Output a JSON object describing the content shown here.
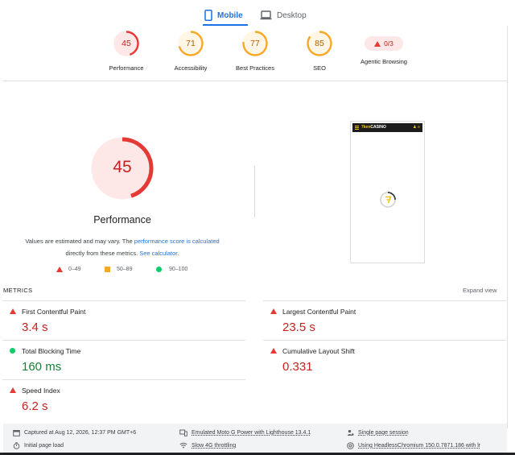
{
  "device_tabs": [
    {
      "label": "Mobile",
      "active": true
    },
    {
      "label": "Desktop",
      "active": false
    }
  ],
  "summary": [
    {
      "score": "45",
      "label": "Performance",
      "value": 0.45,
      "color": "#e53935",
      "text_color": "#c5221f",
      "bg": "#fde7e7"
    },
    {
      "score": "71",
      "label": "Accessibility",
      "value": 0.71,
      "color": "#f8a726",
      "text_color": "#b45f06",
      "bg": "#fff6e6"
    },
    {
      "score": "77",
      "label": "Best Practices",
      "value": 0.77,
      "color": "#f8a726",
      "text_color": "#b45f06",
      "bg": "#fff6e6"
    },
    {
      "score": "85",
      "label": "SEO",
      "value": 0.85,
      "color": "#f8a726",
      "text_color": "#b45f06",
      "bg": "#fff6e6"
    }
  ],
  "agentic": {
    "label": "Agentic Browsing",
    "badge": "0/3"
  },
  "performance": {
    "score": "45",
    "value": 0.45,
    "title": "Performance",
    "note_prefix": "Values are estimated and may vary. The ",
    "note_link": "performance score is calculated",
    "note_middle": " directly from these metrics. ",
    "note_link2": "See calculator.",
    "color": "#e53935"
  },
  "legend": [
    {
      "shape": "triangle",
      "range": "0–49"
    },
    {
      "shape": "square",
      "range": "50–89"
    },
    {
      "shape": "circle",
      "range": "90–100"
    }
  ],
  "screenshot": {
    "logo_a": "7ken",
    "logo_b": "CASINO",
    "icons": "♟ ≡"
  },
  "metrics": {
    "title": "METRICS",
    "expand": "Expand view",
    "items": [
      {
        "label": "First Contentful Paint",
        "value": "3.4 s",
        "status": "fail"
      },
      {
        "label": "Largest Contentful Paint",
        "value": "23.5 s",
        "status": "fail"
      },
      {
        "label": "Total Blocking Time",
        "value": "160 ms",
        "status": "pass"
      },
      {
        "label": "Cumulative Layout Shift",
        "value": "0.331",
        "status": "fail"
      },
      {
        "label": "Speed Index",
        "value": "6.2 s",
        "status": "fail"
      }
    ]
  },
  "footer": {
    "captured": "Captured at Aug 12, 2026, 12:37 PM GMT+6",
    "initial_load": "Initial page load",
    "emulated": "Emulated Moto G Power with Lighthouse 13.4.1",
    "throttling": "Slow 4G throttling",
    "session": "Single page session",
    "browser": "Using HeadlessChromium 150.0.7871.186 with lr"
  },
  "icons": {
    "mobile_tab": "smartphone-icon",
    "desktop_tab": "laptop-icon",
    "captured": "calendar-icon",
    "initial_load": "timer-icon",
    "emulated": "device-icon",
    "throttling": "wifi-icon",
    "session": "person-icon",
    "browser": "chrome-icon"
  }
}
